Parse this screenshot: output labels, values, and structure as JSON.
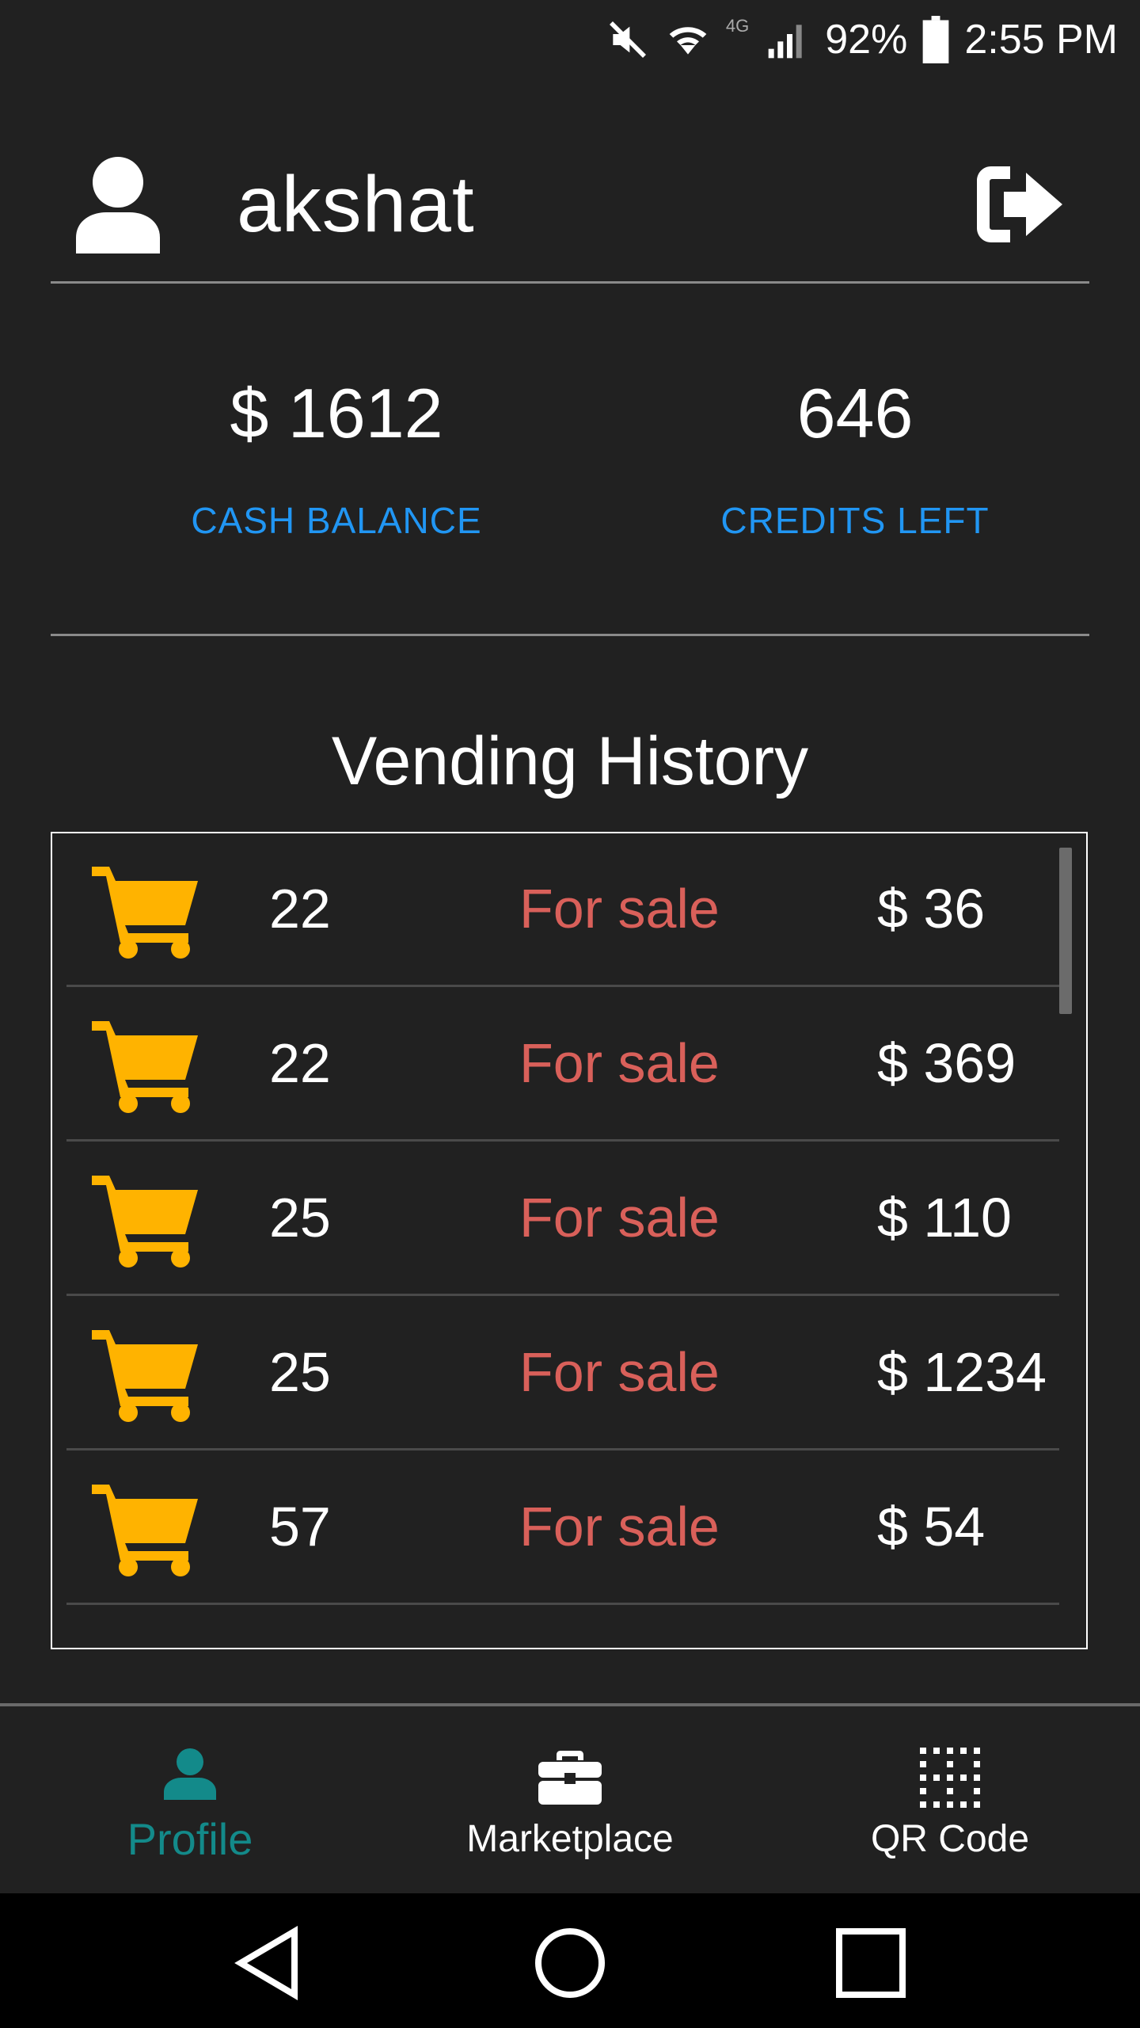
{
  "status_bar": {
    "battery_percent": "92%",
    "time": "2:55 PM",
    "network_badge": "4G"
  },
  "header": {
    "username": "akshat"
  },
  "stats": {
    "cash_value": "$ 1612",
    "cash_label": "CASH BALANCE",
    "credits_value": "646",
    "credits_label": "CREDITS LEFT"
  },
  "history": {
    "title": "Vending History",
    "rows": [
      {
        "id": "22",
        "status": "For sale",
        "price": "$ 36"
      },
      {
        "id": "22",
        "status": "For sale",
        "price": "$ 369"
      },
      {
        "id": "25",
        "status": "For sale",
        "price": "$ 110"
      },
      {
        "id": "25",
        "status": "For sale",
        "price": "$ 1234"
      },
      {
        "id": "57",
        "status": "For sale",
        "price": "$ 54"
      }
    ]
  },
  "nav": {
    "profile_label": "Profile",
    "marketplace_label": "Marketplace",
    "qr_label": "QR Code"
  },
  "colors": {
    "accent_teal": "#138a8a",
    "link_blue": "#2196f3",
    "cart_amber": "#ffb300",
    "status_red": "#d9605a"
  },
  "icons": {
    "avatar": "user-icon",
    "logout": "logout-icon",
    "cart": "cart-icon",
    "profile": "person-icon",
    "marketplace": "briefcase-icon",
    "qr": "qr-grid-icon"
  }
}
